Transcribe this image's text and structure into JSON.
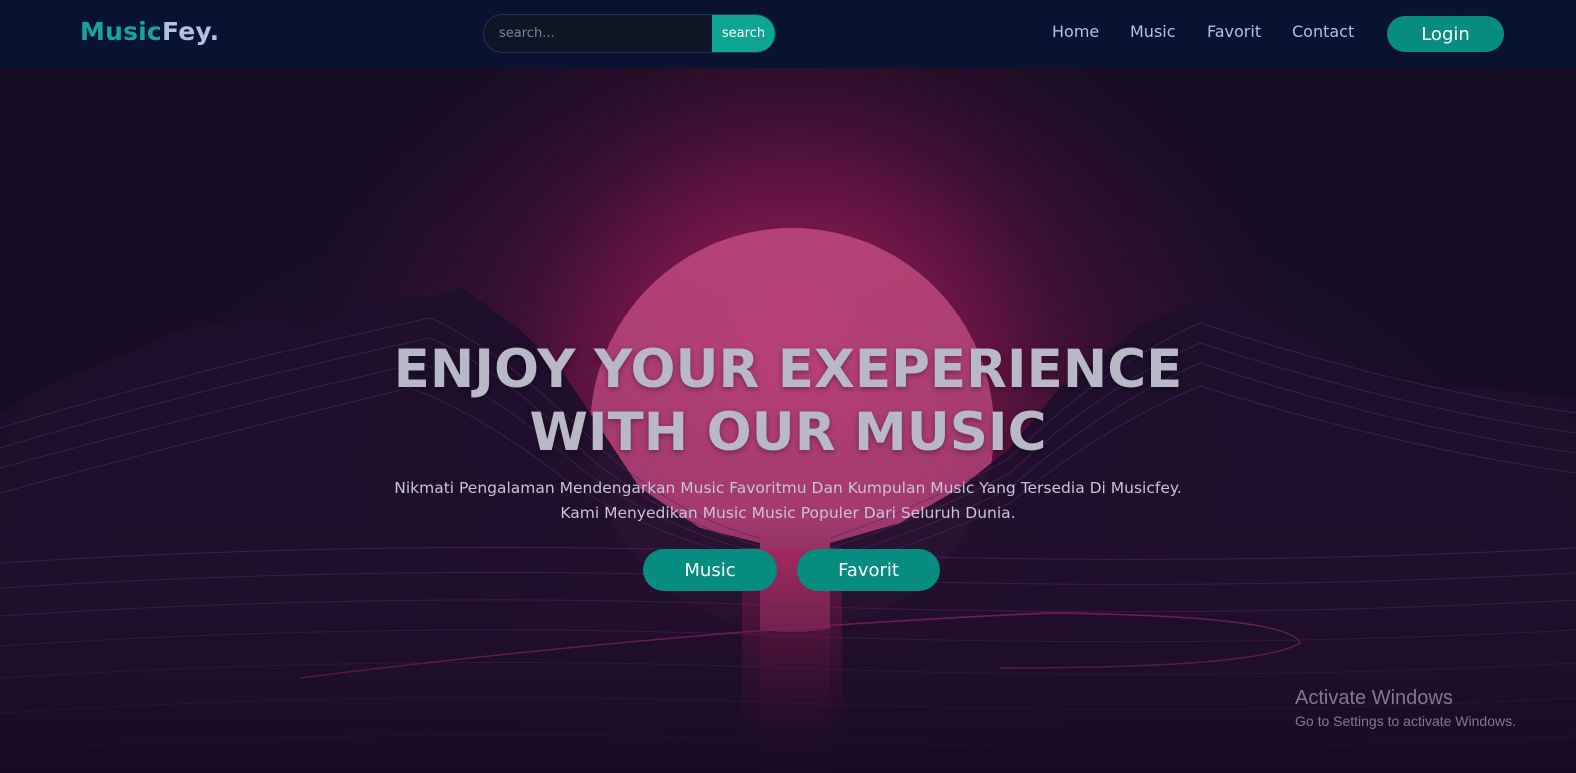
{
  "brand": {
    "part1": "Music",
    "part2": "Fey.",
    "colors": {
      "accent": "#17a59a",
      "secondary": "#b3bfe6",
      "navbar": "#0a1231",
      "button": "#078c80"
    }
  },
  "search": {
    "placeholder": "search...",
    "value": "",
    "button_label": "search"
  },
  "nav": {
    "items": [
      {
        "label": "Home"
      },
      {
        "label": "Music"
      },
      {
        "label": "Favorit"
      },
      {
        "label": "Contact"
      }
    ],
    "login_label": "Login"
  },
  "hero": {
    "title_line1": "ENJOY YOUR EXEPERIENCE",
    "title_line2": "WITH OUR MUSIC",
    "subtitle_line1": "Nikmati Pengalaman Mendengarkan Music Favoritmu Dan Kumpulan Music Yang Tersedia Di Musicfey.",
    "subtitle_line2": "Kami Menyedikan Music Music Populer Dari Seluruh Dunia.",
    "buttons": [
      {
        "label": "Music"
      },
      {
        "label": "Favorit"
      }
    ]
  },
  "os_watermark": {
    "title": "Activate Windows",
    "subtitle": "Go to Settings to activate Windows."
  }
}
